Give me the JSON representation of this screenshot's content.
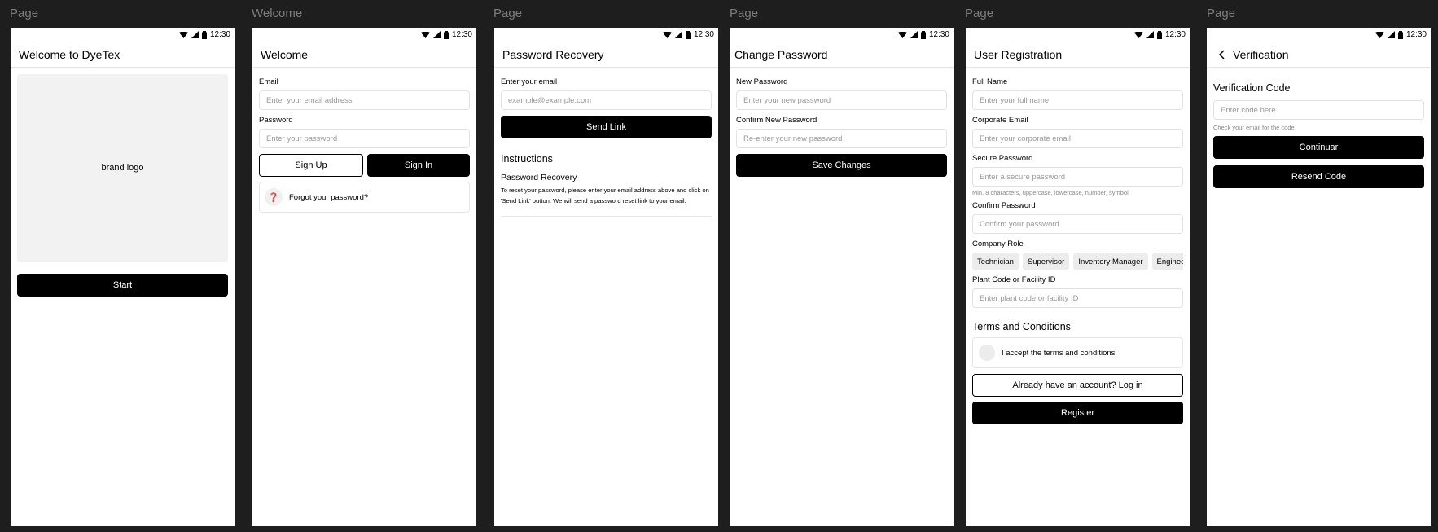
{
  "frames": [
    {
      "label": "Page",
      "status_time": "12:30",
      "title": "Welcome to DyeTex",
      "logo_text": "brand logo",
      "start_button": "Start"
    },
    {
      "label": "Welcome",
      "status_time": "12:30",
      "title": "Welcome",
      "email_label": "Email",
      "email_placeholder": "Enter your email address",
      "password_label": "Password",
      "password_placeholder": "Enter your password",
      "signup_button": "Sign Up",
      "signin_button": "Sign In",
      "forgot_text": "Forgot your password?",
      "forgot_icon": "❓"
    },
    {
      "label": "Page",
      "status_time": "12:30",
      "title": "Password Recovery",
      "email_label": "Enter your email",
      "email_placeholder": "example@example.com",
      "send_button": "Send Link",
      "instructions_title": "Instructions",
      "recovery_title": "Password Recovery",
      "recovery_text": "To reset your password, please enter your email address above and click on 'Send Link' button. We will send a password reset link to your email."
    },
    {
      "label": "Page",
      "status_time": "12:30",
      "title": "Change Password",
      "new_label": "New Password",
      "new_placeholder": "Enter your new password",
      "confirm_label": "Confirm New Password",
      "confirm_placeholder": "Re-enter your new password",
      "save_button": "Save Changes"
    },
    {
      "label": "Page",
      "status_time": "12:30",
      "title": "User Registration",
      "fullname_label": "Full Name",
      "fullname_placeholder": "Enter your full name",
      "corp_email_label": "Corporate Email",
      "corp_email_placeholder": "Enter your corporate email",
      "secure_pw_label": "Secure Password",
      "secure_pw_placeholder": "Enter a secure password",
      "secure_pw_hint": "Min. 8 characters, uppercase, lowercase, number, symbol",
      "confirm_pw_label": "Confirm Password",
      "confirm_pw_placeholder": "Confirm your password",
      "role_label": "Company Role",
      "roles": [
        "Technician",
        "Supervisor",
        "Inventory Manager",
        "Engineer"
      ],
      "plant_label": "Plant Code or Facility ID",
      "plant_placeholder": "Enter plant code or facility ID",
      "terms_title": "Terms and Conditions",
      "terms_text": "I accept the terms and conditions",
      "login_button": "Already have an account? Log in",
      "register_button": "Register"
    },
    {
      "label": "Page",
      "status_time": "12:30",
      "title": "Verification",
      "code_label": "Verification Code",
      "code_placeholder": "Enter code here",
      "code_hint": "Check your email for the code",
      "continue_button": "Continuar",
      "resend_button": "Resend Code"
    }
  ],
  "colors": {
    "canvas": "#1e1e1e",
    "primary": "#000000",
    "field_border": "#e2e2e2",
    "logo_bg": "#f2f2f2"
  }
}
